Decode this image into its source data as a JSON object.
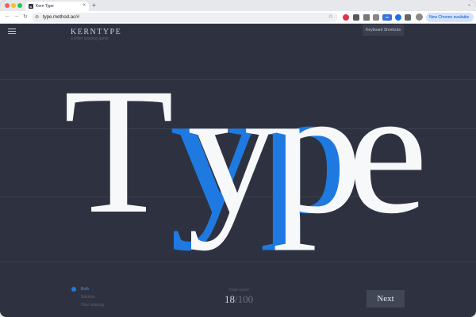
{
  "browser": {
    "tab_title": "Kern Type",
    "favicon_letter": "K",
    "tab_close_icon": "×",
    "new_tab_icon": "+",
    "tab_menu_icon": "⌄",
    "url": "type.method.ac/#",
    "update_chip": "New Chrome available",
    "update_menu_icon": "⋮",
    "ext_badge": "on"
  },
  "header": {
    "brand_title": "KERNTYPE",
    "brand_subtitle": "a letter spacing game",
    "keyboard_shortcuts": "Keyboard Shortcuts"
  },
  "game": {
    "word_letters": [
      "T",
      "y",
      "p",
      "e"
    ],
    "colors": {
      "background": "#2e3240",
      "user_letters": "#f7f8fa",
      "solution_letters": "#1e7ae0"
    }
  },
  "view_options": [
    {
      "label": "Both",
      "selected": true
    },
    {
      "label": "Solution",
      "selected": false
    },
    {
      "label": "Your spacing",
      "selected": false
    }
  ],
  "score": {
    "label": "Your score",
    "value": "18",
    "separator": "/",
    "max": "100"
  },
  "next_button": "Next"
}
